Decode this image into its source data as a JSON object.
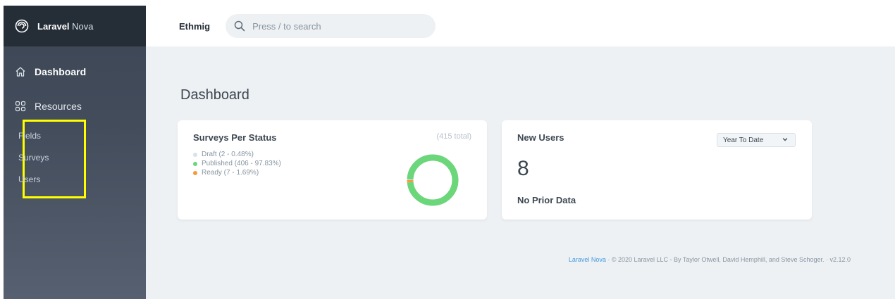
{
  "brand": {
    "name_bold": "Laravel",
    "name_light": "Nova"
  },
  "sidebar": {
    "dashboard_label": "Dashboard",
    "resources_label": "Resources",
    "resources": [
      {
        "label": "Fields"
      },
      {
        "label": "Surveys"
      },
      {
        "label": "Users"
      }
    ],
    "highlight_color": "#ffff00"
  },
  "topbar": {
    "app_name": "Ethmig",
    "search_placeholder": "Press / to search"
  },
  "page": {
    "title": "Dashboard"
  },
  "cards": {
    "surveys": {
      "title": "Surveys Per Status",
      "total": "(415 total)",
      "legend": [
        {
          "label": "Draft (2 - 0.48%)",
          "color": "#dae1e7",
          "percent": 0.48
        },
        {
          "label": "Published (406 - 97.83%)",
          "color": "#6cd67a",
          "percent": 97.83
        },
        {
          "label": "Ready (7 - 1.69%)",
          "color": "#f6993f",
          "percent": 1.69
        }
      ]
    },
    "new_users": {
      "title": "New Users",
      "range_selected": "Year To Date",
      "value": "8",
      "comparison": "No Prior Data"
    }
  },
  "footer": {
    "link": "Laravel Nova",
    "text": " · © 2020 Laravel LLC - By Taylor Otwell, David Hemphill, and Steve Schoger. · v2.12.0"
  },
  "colors": {
    "sidebar_top": "#252d37",
    "accent_link": "#4099de"
  }
}
